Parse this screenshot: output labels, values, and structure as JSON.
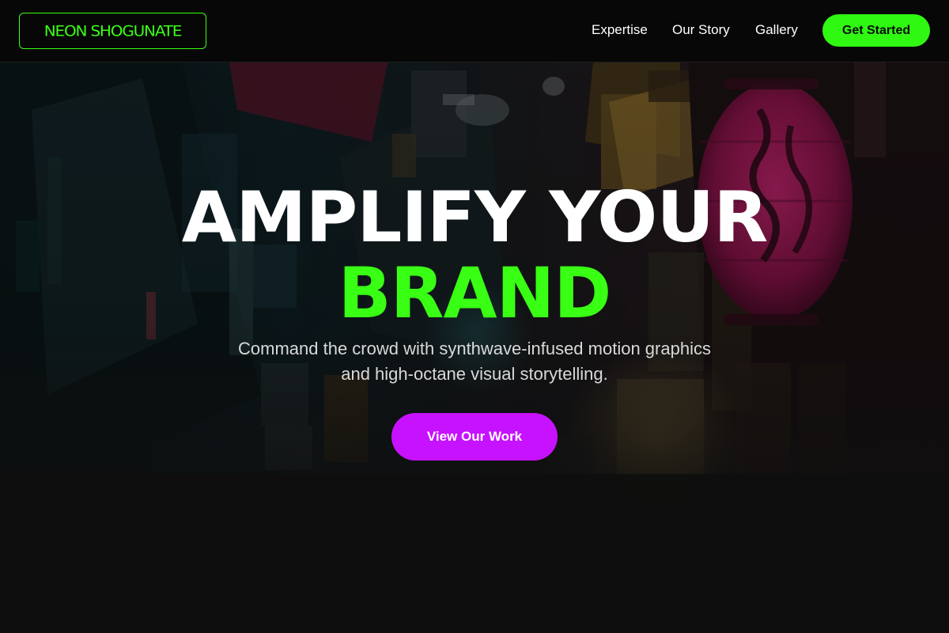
{
  "nav": {
    "logo": "NEON SHOGUNATE",
    "links": [
      {
        "label": "Expertise"
      },
      {
        "label": "Our Story"
      },
      {
        "label": "Gallery"
      }
    ],
    "cta_label": "Get Started"
  },
  "hero": {
    "headline_line1": "AMPLIFY YOUR",
    "headline_line2": "BRAND",
    "subtitle": "Command the crowd with synthwave-infused motion graphics and high-octane visual storytelling.",
    "cta_label": "View Our Work",
    "background_image": "neon-tokyo-alley-photo"
  },
  "colors": {
    "accent_green": "#39ff14",
    "accent_purple": "#c612ff",
    "navbar_bg": "#070707",
    "page_bg": "#0e0e0e",
    "lantern_pink": "#c21d6a"
  }
}
